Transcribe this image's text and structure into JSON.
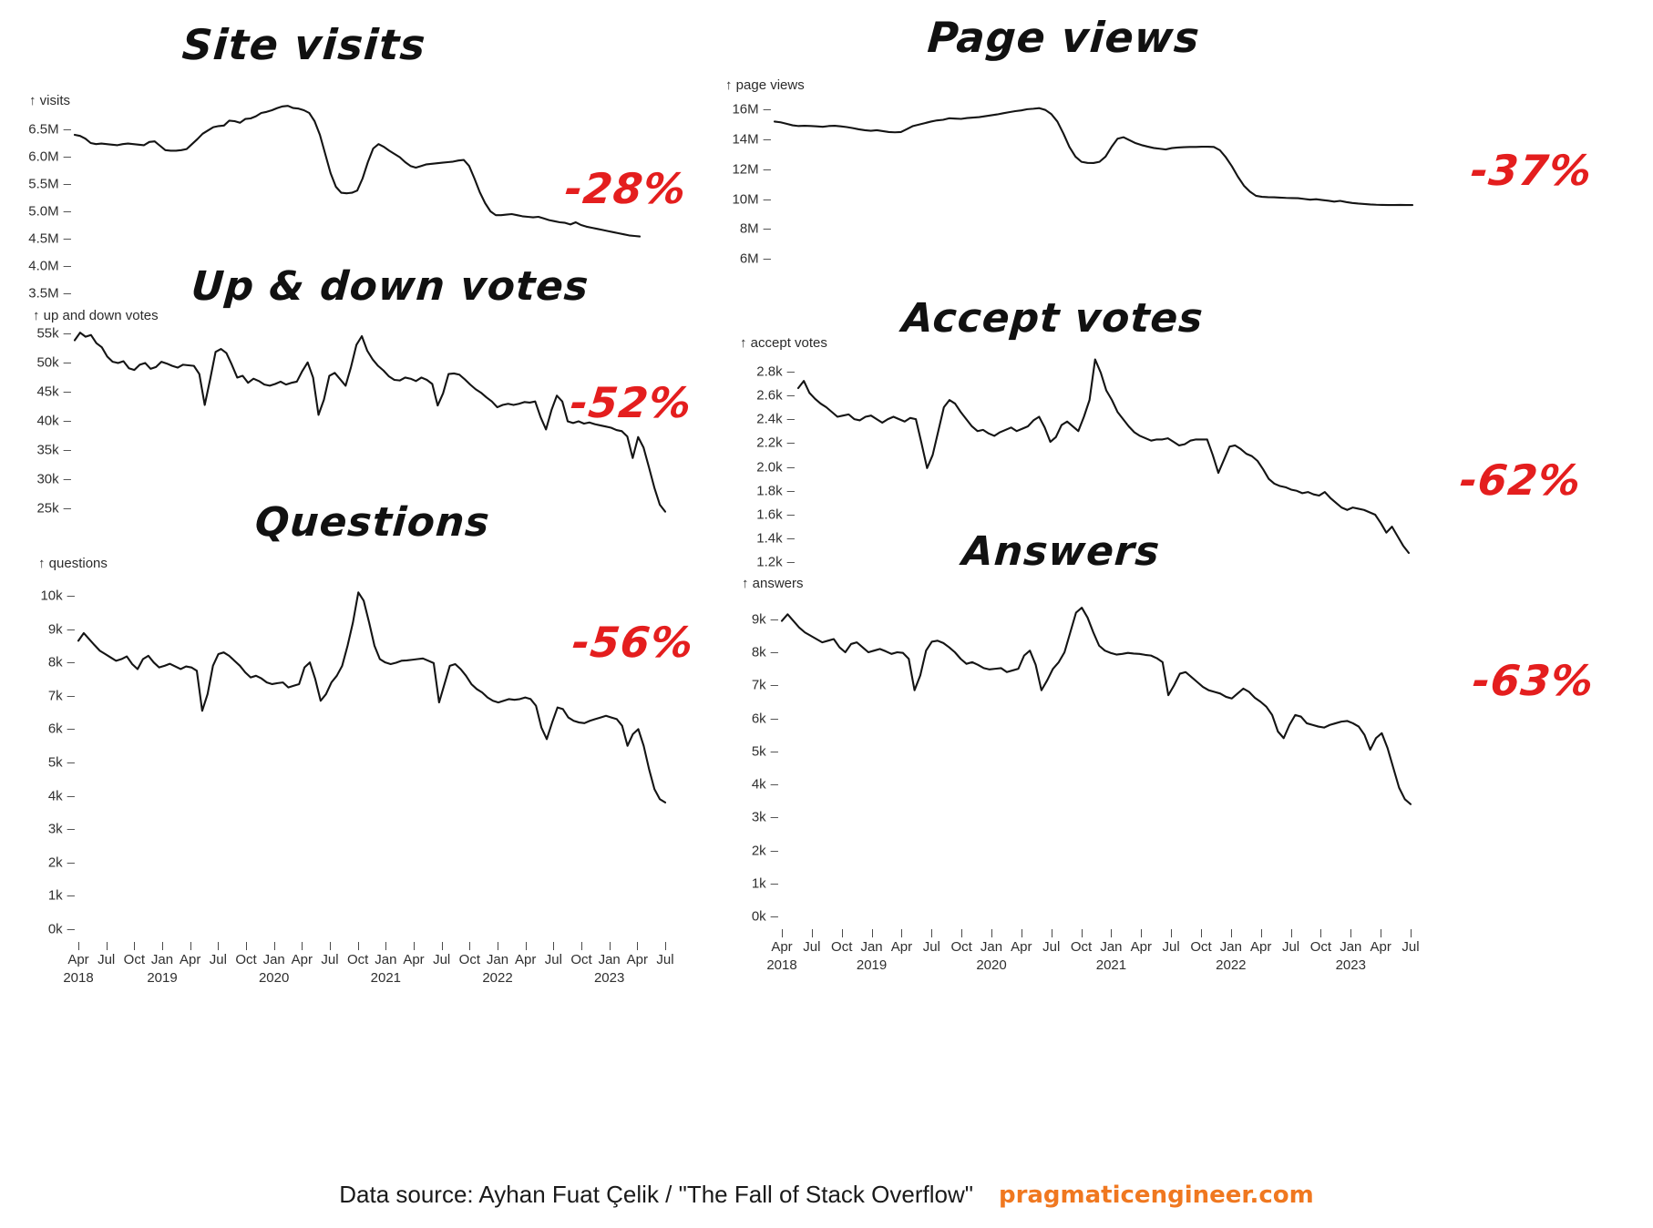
{
  "footer": {
    "source_text": "Data source: Ayhan Fuat Çelik / \"The Fall of Stack Overflow\"",
    "brand": "pragmaticengineer.com",
    "brand_color": "#f07820"
  },
  "accent_color": "#e41e1e",
  "line_color": "#141414",
  "shared_x": {
    "months": [
      "Apr",
      "Jul",
      "Oct",
      "Jan",
      "Apr",
      "Jul",
      "Oct",
      "Jan",
      "Apr",
      "Jul",
      "Oct",
      "Jan",
      "Apr",
      "Jul",
      "Oct",
      "Jan",
      "Apr",
      "Jul",
      "Oct",
      "Jan",
      "Apr",
      "Jul"
    ],
    "years": [
      "2018",
      "",
      "",
      "2019",
      "",
      "",
      "",
      "2020",
      "",
      "",
      "",
      "2021",
      "",
      "",
      "",
      "2022",
      "",
      "",
      "",
      "2023",
      "",
      ""
    ],
    "range": [
      "Apr 2018",
      "Jul 2023"
    ]
  },
  "chart_data": [
    {
      "id": "site-visits",
      "type": "line",
      "title": "Site visits",
      "axis_caption": "↑ visits",
      "annotation": "-28%",
      "ylabel": "visits",
      "xlabel": "",
      "ytick_labels": [
        "6.5M",
        "6.0M",
        "5.5M",
        "5.0M",
        "4.5M",
        "4.0M",
        "3.5M"
      ],
      "ytick_values": [
        6500000,
        6000000,
        5500000,
        5000000,
        4500000,
        4000000,
        3500000
      ],
      "ylim": [
        3500000,
        7000000
      ],
      "xlim": [
        "Apr 2018",
        "Jul 2023"
      ],
      "grid": false,
      "legend": "none",
      "values": [
        6400000,
        6380000,
        6330000,
        6250000,
        6230000,
        6240000,
        6230000,
        6220000,
        6210000,
        6230000,
        6240000,
        6230000,
        6220000,
        6210000,
        6270000,
        6280000,
        6200000,
        6120000,
        6110000,
        6110000,
        6120000,
        6140000,
        6230000,
        6320000,
        6420000,
        6480000,
        6540000,
        6560000,
        6570000,
        6660000,
        6650000,
        6620000,
        6690000,
        6700000,
        6740000,
        6800000,
        6820000,
        6850000,
        6890000,
        6920000,
        6930000,
        6890000,
        6880000,
        6850000,
        6800000,
        6650000,
        6400000,
        6050000,
        5700000,
        5450000,
        5340000,
        5330000,
        5340000,
        5380000,
        5600000,
        5900000,
        6150000,
        6230000,
        6180000,
        6110000,
        6050000,
        5990000,
        5900000,
        5830000,
        5800000,
        5830000,
        5860000,
        5870000,
        5880000,
        5890000,
        5900000,
        5910000,
        5930000,
        5940000,
        5830000,
        5600000,
        5350000,
        5150000,
        5000000,
        4930000,
        4930000,
        4940000,
        4950000,
        4930000,
        4910000,
        4900000,
        4890000,
        4900000,
        4870000,
        4840000,
        4820000,
        4800000,
        4790000,
        4760000,
        4800000,
        4750000,
        4720000,
        4700000,
        4680000,
        4660000,
        4640000,
        4620000,
        4600000,
        4580000,
        4560000,
        4550000,
        4540000
      ]
    },
    {
      "id": "page-views",
      "type": "line",
      "title": "Page views",
      "axis_caption": "↑ page views",
      "annotation": "-37%",
      "ylabel": "page views",
      "xlabel": "",
      "ytick_labels": [
        "16M",
        "14M",
        "12M",
        "10M",
        "8M",
        "6M"
      ],
      "ytick_values": [
        16000000,
        14000000,
        12000000,
        10000000,
        8000000,
        6000000
      ],
      "ylim": [
        6000000,
        17000000
      ],
      "xlim": [
        "Apr 2018",
        "Jul 2023"
      ],
      "grid": false,
      "legend": "none",
      "values": [
        15200000,
        15150000,
        15050000,
        14950000,
        14900000,
        14920000,
        14900000,
        14880000,
        14850000,
        14900000,
        14920000,
        14880000,
        14830000,
        14760000,
        14680000,
        14620000,
        14580000,
        14620000,
        14560000,
        14500000,
        14480000,
        14500000,
        14700000,
        14900000,
        15000000,
        15100000,
        15200000,
        15280000,
        15320000,
        15420000,
        15400000,
        15380000,
        15440000,
        15470000,
        15500000,
        15560000,
        15620000,
        15680000,
        15760000,
        15830000,
        15900000,
        15950000,
        16030000,
        16060000,
        16100000,
        15980000,
        15700000,
        15200000,
        14400000,
        13500000,
        12850000,
        12500000,
        12430000,
        12420000,
        12500000,
        12850000,
        13500000,
        14050000,
        14150000,
        13950000,
        13750000,
        13620000,
        13520000,
        13430000,
        13380000,
        13330000,
        13420000,
        13460000,
        13480000,
        13500000,
        13500000,
        13510000,
        13510000,
        13500000,
        13280000,
        12800000,
        12200000,
        11500000,
        10900000,
        10500000,
        10220000,
        10150000,
        10130000,
        10120000,
        10100000,
        10080000,
        10070000,
        10060000,
        10010000,
        9960000,
        9990000,
        9940000,
        9890000,
        9830000,
        9880000,
        9800000,
        9740000,
        9700000,
        9670000,
        9640000,
        9620000,
        9610000,
        9600000,
        9600000,
        9610000,
        9600000,
        9600000
      ]
    },
    {
      "id": "up-and-down-votes",
      "type": "line",
      "title": "Up & down votes",
      "axis_caption": "↑ up and down votes",
      "annotation": "-52%",
      "ylabel": "up and down votes",
      "xlabel": "",
      "ytick_labels": [
        "55k",
        "50k",
        "45k",
        "40k",
        "35k",
        "30k",
        "25k"
      ],
      "ytick_values": [
        55000,
        50000,
        45000,
        40000,
        35000,
        30000,
        25000
      ],
      "ylim": [
        22000,
        57000
      ],
      "xlim": [
        "Apr 2018",
        "Jul 2023"
      ],
      "grid": false,
      "legend": "none",
      "values": [
        53800,
        55100,
        54400,
        54700,
        53300,
        52600,
        51000,
        50100,
        49900,
        50200,
        49000,
        48700,
        49600,
        49900,
        48900,
        49200,
        50100,
        49800,
        49400,
        49100,
        49600,
        49500,
        49400,
        48000,
        42700,
        47100,
        51800,
        52300,
        51600,
        49600,
        47400,
        47700,
        46500,
        47200,
        46800,
        46200,
        46000,
        46300,
        46700,
        46200,
        46500,
        46700,
        48500,
        50000,
        47400,
        41000,
        43600,
        47700,
        48200,
        47100,
        46000,
        49200,
        53000,
        54500,
        52000,
        50500,
        49400,
        48600,
        47600,
        47000,
        46900,
        47400,
        47200,
        46800,
        47400,
        47000,
        46300,
        42600,
        44700,
        48000,
        48100,
        47900,
        47100,
        46200,
        45400,
        44800,
        44000,
        43300,
        42300,
        42700,
        42900,
        42700,
        42900,
        43200,
        43100,
        43300,
        40600,
        38500,
        41800,
        44300,
        43300,
        39900,
        39600,
        39900,
        39500,
        39700,
        39400,
        39200,
        39000,
        38800,
        38400,
        38200,
        37300,
        33600,
        37200,
        35400,
        32000,
        28500,
        25600,
        24400
      ]
    },
    {
      "id": "accept-votes",
      "type": "line",
      "title": "Accept votes",
      "axis_caption": "↑ accept votes",
      "annotation": "-62%",
      "ylabel": "accept votes",
      "xlabel": "",
      "ytick_labels": [
        "2.8k",
        "2.6k",
        "2.4k",
        "2.2k",
        "2.0k",
        "1.8k",
        "1.6k",
        "1.4k",
        "1.2k"
      ],
      "ytick_values": [
        2800,
        2600,
        2400,
        2200,
        2000,
        1800,
        1600,
        1400,
        1200
      ],
      "ylim": [
        1150,
        2950
      ],
      "xlim": [
        "Apr 2018",
        "Jul 2023"
      ],
      "grid": false,
      "legend": "none",
      "values": [
        2660,
        2720,
        2620,
        2570,
        2530,
        2500,
        2460,
        2420,
        2430,
        2440,
        2400,
        2390,
        2420,
        2430,
        2400,
        2370,
        2400,
        2420,
        2400,
        2380,
        2410,
        2400,
        2200,
        1990,
        2100,
        2300,
        2500,
        2560,
        2530,
        2460,
        2400,
        2340,
        2300,
        2310,
        2280,
        2260,
        2290,
        2310,
        2330,
        2300,
        2320,
        2340,
        2390,
        2420,
        2330,
        2210,
        2250,
        2350,
        2380,
        2340,
        2300,
        2420,
        2560,
        2900,
        2790,
        2640,
        2560,
        2460,
        2400,
        2340,
        2290,
        2260,
        2240,
        2220,
        2230,
        2230,
        2240,
        2210,
        2180,
        2190,
        2220,
        2230,
        2230,
        2230,
        2100,
        1950,
        2060,
        2170,
        2180,
        2150,
        2110,
        2090,
        2050,
        1980,
        1900,
        1860,
        1840,
        1830,
        1810,
        1800,
        1780,
        1790,
        1770,
        1760,
        1790,
        1740,
        1700,
        1660,
        1640,
        1660,
        1650,
        1640,
        1620,
        1600,
        1530,
        1450,
        1500,
        1420,
        1340,
        1280
      ]
    },
    {
      "id": "questions",
      "type": "line",
      "title": "Questions",
      "axis_caption": "↑ questions",
      "annotation": "-56%",
      "ylabel": "questions",
      "xlabel": "",
      "ytick_labels": [
        "10k",
        "9k",
        "8k",
        "7k",
        "6k",
        "5k",
        "4k",
        "3k",
        "2k",
        "1k",
        "0k"
      ],
      "ytick_values": [
        10000,
        9000,
        8000,
        7000,
        6000,
        5000,
        4000,
        3000,
        2000,
        1000,
        0
      ],
      "ylim": [
        0,
        10600
      ],
      "xlim": [
        "Apr 2018",
        "Jul 2023"
      ],
      "grid": false,
      "legend": "none",
      "values": [
        8650,
        8880,
        8700,
        8520,
        8350,
        8250,
        8150,
        8050,
        8100,
        8180,
        7950,
        7800,
        8100,
        8200,
        8000,
        7850,
        7900,
        7960,
        7880,
        7800,
        7880,
        7850,
        7750,
        6550,
        7050,
        7900,
        8250,
        8300,
        8200,
        8050,
        7900,
        7700,
        7550,
        7600,
        7520,
        7400,
        7350,
        7380,
        7400,
        7250,
        7300,
        7350,
        7850,
        8000,
        7500,
        6850,
        7050,
        7400,
        7600,
        7900,
        8500,
        9200,
        10100,
        9850,
        9200,
        8500,
        8100,
        8000,
        7950,
        7990,
        8050,
        8060,
        8080,
        8100,
        8120,
        8050,
        7980,
        6800,
        7350,
        7900,
        7950,
        7800,
        7600,
        7350,
        7200,
        7100,
        6950,
        6850,
        6800,
        6850,
        6900,
        6880,
        6900,
        6950,
        6900,
        6700,
        6050,
        5700,
        6200,
        6650,
        6600,
        6350,
        6250,
        6200,
        6180,
        6250,
        6300,
        6350,
        6400,
        6350,
        6300,
        6100,
        5500,
        5850,
        6000,
        5500,
        4800,
        4200,
        3900,
        3800
      ]
    },
    {
      "id": "answers",
      "type": "line",
      "title": "Answers",
      "axis_caption": "↑ answers",
      "annotation": "-63%",
      "ylabel": "answers",
      "xlabel": "",
      "ytick_labels": [
        "9k",
        "8k",
        "7k",
        "6k",
        "5k",
        "4k",
        "3k",
        "2k",
        "1k",
        "0k"
      ],
      "ytick_values": [
        9000,
        8000,
        7000,
        6000,
        5000,
        4000,
        3000,
        2000,
        1000,
        0
      ],
      "ylim": [
        0,
        9600
      ],
      "xlim": [
        "Apr 2018",
        "Jul 2023"
      ],
      "grid": false,
      "legend": "none",
      "values": [
        8950,
        9150,
        8950,
        8750,
        8600,
        8500,
        8400,
        8300,
        8350,
        8400,
        8150,
        8000,
        8250,
        8300,
        8150,
        8000,
        8050,
        8100,
        8030,
        7950,
        8000,
        7980,
        7800,
        6850,
        7300,
        8050,
        8320,
        8350,
        8280,
        8150,
        8000,
        7800,
        7650,
        7700,
        7620,
        7520,
        7480,
        7500,
        7520,
        7400,
        7450,
        7500,
        7900,
        8050,
        7620,
        6850,
        7150,
        7500,
        7700,
        8000,
        8600,
        9200,
        9350,
        9050,
        8600,
        8200,
        8050,
        7980,
        7930,
        7950,
        7980,
        7960,
        7950,
        7920,
        7900,
        7820,
        7700,
        6700,
        7000,
        7350,
        7400,
        7250,
        7100,
        6950,
        6850,
        6800,
        6750,
        6650,
        6600,
        6750,
        6900,
        6800,
        6620,
        6500,
        6350,
        6100,
        5600,
        5400,
        5800,
        6100,
        6050,
        5850,
        5800,
        5750,
        5720,
        5800,
        5850,
        5900,
        5920,
        5850,
        5750,
        5500,
        5050,
        5400,
        5550,
        5100,
        4500,
        3900,
        3550,
        3400
      ]
    }
  ]
}
